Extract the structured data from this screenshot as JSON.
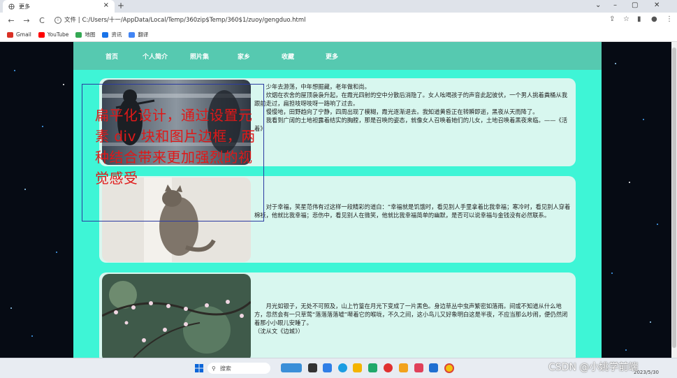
{
  "browser": {
    "tab_title": "更多",
    "tab_close": "×",
    "new_tab": "+",
    "window_controls": [
      "⌄",
      "–",
      "▢",
      "✕"
    ],
    "nav": {
      "back": "←",
      "forward": "→",
      "reload": "C"
    },
    "url_prefix": "文件 |",
    "url": "C:/Users/十一/AppData/Local/Temp/360zip$Temp/360$1/zuoy/gengduo.html",
    "bookmarks": [
      {
        "label": "Gmail",
        "color": "#d93025"
      },
      {
        "label": "YouTube",
        "color": "#ff0000"
      },
      {
        "label": "地图",
        "color": "#34a853"
      },
      {
        "label": "资讯",
        "color": "#1a73e8"
      },
      {
        "label": "翻译",
        "color": "#4285f4"
      }
    ]
  },
  "site": {
    "nav_items": [
      "首页",
      "个人简介",
      "照片集",
      "家乡",
      "收藏",
      "更多"
    ],
    "cards": [
      {
        "paragraphs": [
          "少年去游荡，中年想掘藏，老年做和尚。",
          "炊烟在农舍的屋顶袅袅升起，在霞光四射的空中分散后消隐了。女人吆喝孩子的声音此起彼伏，一个男人挑着粪桶从我跟前走过，扁担吱呀吱呀一路响了过去。",
          "慢慢地，田野趋向了宁静，四周出现了模糊，霞光逐渐退去。我知道黄昏正在转瞬即逝，黑夜从天而降了。",
          "我看到广阔的土地袒露着结实的胸膛，那是召唤的姿态，就像女人召唤着她们的儿女，土地召唤着黑夜来临。——《活着》"
        ]
      },
      {
        "paragraphs": [
          "对于幸福，笑星范伟有过这样一段精彩的道白：“幸福就是饥饿时，看见别人手里拿着比我幸福；寒冷时，看见别人穿着棉袄，他就比我幸福；悲伤中，看见别人在微笑，他就比我幸福简单的幽默，是否可以说幸福与金钱没有必然联系。"
        ]
      },
      {
        "paragraphs": [
          "月光如银子，无处不可照及，山上竹篁在月光下变成了一片黑色。身边草丛中虫声繁密如落雨。间或不知道从什么地方，忽然会有一只草莺“落落落落嘘”啭着它的喉咙，不久之间，这小鸟儿又好象明白这是半夜，不应当那么吵闹，便仍然闭着那小小眼儿安睡了。"
        ],
        "cite": "（沈从文《边城》）"
      }
    ]
  },
  "annotation": {
    "text": "扁平化设计，通过设置元素 div 块和图片边框，两种结合带来更加强烈的视觉感受",
    "color": "#e01818"
  },
  "taskbar": {
    "search_placeholder": "搜索",
    "watermark": "CSDN @小姚学前端",
    "date": "2023/5/30"
  }
}
